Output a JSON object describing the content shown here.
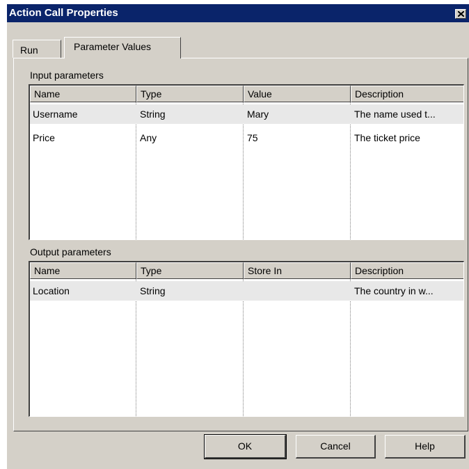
{
  "window": {
    "title": "Action Call Properties",
    "close_icon": "close-icon"
  },
  "tabs": [
    {
      "label": "Run",
      "active": false
    },
    {
      "label": "Parameter Values",
      "active": true
    }
  ],
  "input_parameters": {
    "label": "Input parameters",
    "columns": [
      "Name",
      "Type",
      "Value",
      "Description"
    ],
    "rows": [
      [
        "Username",
        "String",
        "Mary",
        "The name used t..."
      ],
      [
        "Price",
        "Any",
        "75",
        "The ticket price"
      ]
    ]
  },
  "output_parameters": {
    "label": "Output parameters",
    "columns": [
      "Name",
      "Type",
      "Store In",
      "Description"
    ],
    "rows": [
      [
        "Location",
        "String",
        "",
        "The country in w..."
      ]
    ]
  },
  "buttons": {
    "ok": "OK",
    "cancel": "Cancel",
    "help": "Help"
  }
}
